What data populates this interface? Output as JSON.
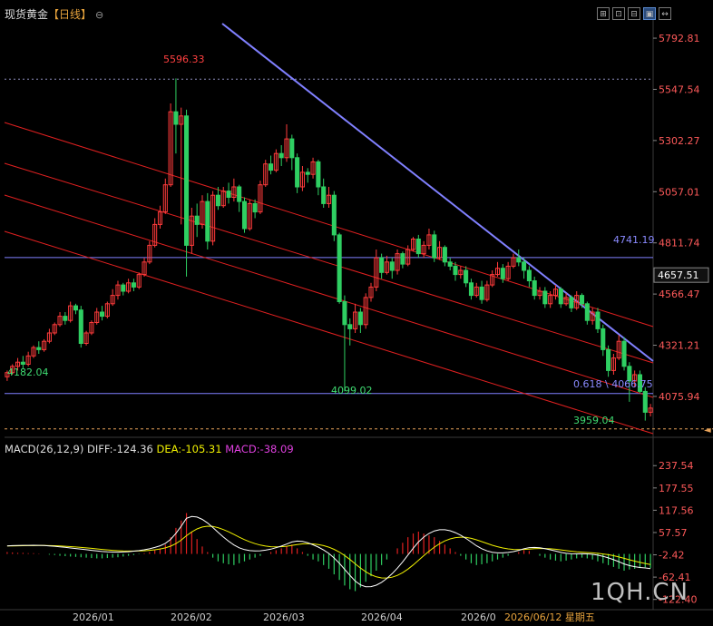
{
  "header": {
    "title": "现货黄金",
    "period": "【日线】",
    "settings_glyph": "⊖"
  },
  "toolbar": {
    "items": [
      {
        "glyph": "⊞",
        "name": "crosshair-icon"
      },
      {
        "glyph": "⊡",
        "name": "zoom-icon"
      },
      {
        "glyph": "⊟",
        "name": "layout-icon"
      },
      {
        "glyph": "▣",
        "name": "chart-type-icon"
      },
      {
        "glyph": "↔",
        "name": "expand-icon"
      }
    ]
  },
  "price_axis": {
    "ticks": [
      "5792.81",
      "5547.54",
      "5302.27",
      "5057.01",
      "4811.74",
      "4566.47",
      "4321.21",
      "4075.94"
    ]
  },
  "current_price": {
    "label": "4657.51",
    "value": 4657.51
  },
  "tail_arrow": "◄",
  "labels": {
    "high": "5596.33",
    "start": "4182.04",
    "low_march": "4099.02",
    "level_4741": "4741.19",
    "fib": "0.618 \\ 4066.75",
    "low_recent": "3959.04"
  },
  "macd": {
    "name": "MACD(26,12,9)",
    "diff_label": "DIFF:-124.36",
    "dea_label": "DEA:-105.31",
    "macd_label": "MACD:-38.09",
    "ticks": [
      "237.54",
      "177.55",
      "117.56",
      "57.57",
      "-2.42",
      "-62.41",
      "-122.40"
    ]
  },
  "x_axis": {
    "labels": [
      "2026/01",
      "2026/02",
      "2026/03",
      "2026/04",
      "2026/0"
    ],
    "cursor_label": "2026/06/12 星期五"
  },
  "watermark": "1QH.CN",
  "colors": {
    "up": "#ff3b3b",
    "down": "#2fcf62",
    "trend": "#8080ff",
    "channel": "#e02020",
    "dash": "#e8a35a",
    "diff": "#ffffff",
    "dea": "#f0f000",
    "hist_up": "#e02020",
    "hist_down": "#2fcf62"
  },
  "chart_data": {
    "type": "candlestick",
    "candles": [
      [
        4170,
        4190,
        4150,
        4200
      ],
      [
        4190,
        4220,
        4180,
        4230
      ],
      [
        4220,
        4240,
        4200,
        4260
      ],
      [
        4240,
        4230,
        4210,
        4270
      ],
      [
        4230,
        4270,
        4220,
        4290
      ],
      [
        4270,
        4310,
        4260,
        4320
      ],
      [
        4310,
        4300,
        4280,
        4340
      ],
      [
        4300,
        4340,
        4290,
        4350
      ],
      [
        4340,
        4380,
        4330,
        4400
      ],
      [
        4380,
        4420,
        4370,
        4430
      ],
      [
        4420,
        4460,
        4410,
        4480
      ],
      [
        4460,
        4440,
        4420,
        4480
      ],
      [
        4440,
        4510,
        4430,
        4530
      ],
      [
        4510,
        4490,
        4470,
        4520
      ],
      [
        4490,
        4330,
        4310,
        4510
      ],
      [
        4330,
        4380,
        4320,
        4390
      ],
      [
        4380,
        4430,
        4370,
        4440
      ],
      [
        4430,
        4480,
        4420,
        4500
      ],
      [
        4480,
        4460,
        4440,
        4510
      ],
      [
        4460,
        4520,
        4450,
        4530
      ],
      [
        4520,
        4560,
        4510,
        4590
      ],
      [
        4560,
        4610,
        4540,
        4630
      ],
      [
        4610,
        4580,
        4560,
        4620
      ],
      [
        4580,
        4620,
        4570,
        4640
      ],
      [
        4620,
        4600,
        4580,
        4640
      ],
      [
        4600,
        4660,
        4590,
        4670
      ],
      [
        4660,
        4720,
        4650,
        4740
      ],
      [
        4720,
        4800,
        4710,
        4820
      ],
      [
        4800,
        4900,
        4790,
        4930
      ],
      [
        4900,
        4960,
        4880,
        4990
      ],
      [
        4960,
        5090,
        4950,
        5120
      ],
      [
        5090,
        5440,
        5080,
        5480
      ],
      [
        5440,
        5380,
        5240,
        5600
      ],
      [
        5380,
        5420,
        4900,
        5460
      ],
      [
        5420,
        4800,
        4650,
        5450
      ],
      [
        4800,
        4940,
        4760,
        4980
      ],
      [
        4940,
        4900,
        4840,
        5000
      ],
      [
        4900,
        5010,
        4880,
        5040
      ],
      [
        5010,
        4820,
        4780,
        5050
      ],
      [
        4820,
        5040,
        4800,
        5060
      ],
      [
        5040,
        4990,
        4970,
        5080
      ],
      [
        4990,
        5060,
        4980,
        5080
      ],
      [
        5060,
        5030,
        5000,
        5100
      ],
      [
        5030,
        5080,
        5010,
        5120
      ],
      [
        5080,
        5010,
        4960,
        5090
      ],
      [
        5010,
        4880,
        4860,
        5030
      ],
      [
        4880,
        5000,
        4870,
        5020
      ],
      [
        5000,
        4960,
        4930,
        5020
      ],
      [
        4960,
        5090,
        4950,
        5110
      ],
      [
        5090,
        5190,
        5080,
        5210
      ],
      [
        5190,
        5160,
        5140,
        5230
      ],
      [
        5160,
        5240,
        5150,
        5260
      ],
      [
        5240,
        5220,
        5180,
        5280
      ],
      [
        5220,
        5310,
        5200,
        5380
      ],
      [
        5310,
        5220,
        5160,
        5330
      ],
      [
        5220,
        5080,
        5050,
        5240
      ],
      [
        5080,
        5150,
        5060,
        5180
      ],
      [
        5150,
        5140,
        5100,
        5170
      ],
      [
        5140,
        5200,
        5120,
        5220
      ],
      [
        5200,
        5080,
        5040,
        5210
      ],
      [
        5080,
        5000,
        4980,
        5120
      ],
      [
        5000,
        5040,
        4980,
        5080
      ],
      [
        5040,
        4850,
        4820,
        5060
      ],
      [
        4850,
        4530,
        4520,
        4860
      ],
      [
        4530,
        4420,
        4100,
        4560
      ],
      [
        4420,
        4400,
        4320,
        4450
      ],
      [
        4400,
        4480,
        4380,
        4520
      ],
      [
        4480,
        4420,
        4380,
        4500
      ],
      [
        4420,
        4550,
        4400,
        4570
      ],
      [
        4550,
        4600,
        4530,
        4620
      ],
      [
        4600,
        4740,
        4580,
        4780
      ],
      [
        4740,
        4670,
        4640,
        4760
      ],
      [
        4670,
        4720,
        4660,
        4750
      ],
      [
        4720,
        4680,
        4640,
        4740
      ],
      [
        4680,
        4760,
        4660,
        4780
      ],
      [
        4760,
        4710,
        4690,
        4770
      ],
      [
        4710,
        4780,
        4700,
        4800
      ],
      [
        4780,
        4830,
        4770,
        4840
      ],
      [
        4830,
        4760,
        4740,
        4850
      ],
      [
        4760,
        4800,
        4740,
        4820
      ],
      [
        4800,
        4850,
        4780,
        4880
      ],
      [
        4850,
        4740,
        4720,
        4870
      ],
      [
        4740,
        4790,
        4730,
        4820
      ],
      [
        4790,
        4720,
        4700,
        4800
      ],
      [
        4720,
        4700,
        4680,
        4740
      ],
      [
        4700,
        4660,
        4630,
        4720
      ],
      [
        4660,
        4680,
        4640,
        4700
      ],
      [
        4680,
        4620,
        4600,
        4700
      ],
      [
        4620,
        4560,
        4540,
        4640
      ],
      [
        4560,
        4600,
        4550,
        4620
      ],
      [
        4600,
        4540,
        4520,
        4630
      ],
      [
        4540,
        4610,
        4530,
        4630
      ],
      [
        4610,
        4660,
        4600,
        4680
      ],
      [
        4660,
        4690,
        4650,
        4720
      ],
      [
        4690,
        4640,
        4620,
        4710
      ],
      [
        4640,
        4700,
        4630,
        4720
      ],
      [
        4700,
        4740,
        4690,
        4760
      ],
      [
        4740,
        4720,
        4700,
        4780
      ],
      [
        4720,
        4680,
        4640,
        4740
      ],
      [
        4680,
        4630,
        4600,
        4700
      ],
      [
        4630,
        4560,
        4540,
        4650
      ],
      [
        4560,
        4580,
        4540,
        4600
      ],
      [
        4580,
        4520,
        4500,
        4600
      ],
      [
        4520,
        4560,
        4500,
        4580
      ],
      [
        4560,
        4590,
        4540,
        4610
      ],
      [
        4590,
        4520,
        4500,
        4600
      ],
      [
        4520,
        4550,
        4510,
        4570
      ],
      [
        4550,
        4500,
        4480,
        4560
      ],
      [
        4500,
        4560,
        4490,
        4580
      ],
      [
        4560,
        4520,
        4500,
        4570
      ],
      [
        4520,
        4440,
        4420,
        4530
      ],
      [
        4440,
        4480,
        4420,
        4500
      ],
      [
        4480,
        4400,
        4380,
        4500
      ],
      [
        4400,
        4300,
        4270,
        4420
      ],
      [
        4300,
        4200,
        4170,
        4320
      ],
      [
        4200,
        4260,
        4180,
        4280
      ],
      [
        4260,
        4340,
        4250,
        4370
      ],
      [
        4340,
        4220,
        4200,
        4360
      ],
      [
        4220,
        4150,
        4050,
        4240
      ],
      [
        4150,
        4180,
        4120,
        4200
      ],
      [
        4180,
        4100,
        4090,
        4200
      ],
      [
        4100,
        4000,
        3960,
        4120
      ],
      [
        4000,
        4020,
        3980,
        4040
      ]
    ],
    "fib_level": 4066.75,
    "horizontal_level": 4741.19,
    "high_price": 5596.33,
    "ylim": [
      3880,
      5880
    ],
    "macd_ylim": [
      -150,
      265
    ],
    "macd_hist": [
      5,
      4,
      3,
      3,
      2,
      2,
      1,
      0,
      -2,
      -3,
      -5,
      -6,
      -7,
      -8,
      -9,
      -10,
      -11,
      -12,
      -12,
      -11,
      -10,
      -9,
      -7,
      -5,
      -3,
      -1,
      2,
      5,
      10,
      15,
      25,
      45,
      70,
      90,
      110,
      60,
      40,
      20,
      5,
      -10,
      -20,
      -25,
      -28,
      -30,
      -25,
      -20,
      -15,
      -10,
      -5,
      0,
      5,
      10,
      15,
      20,
      25,
      15,
      5,
      -5,
      -15,
      -20,
      -30,
      -40,
      -55,
      -70,
      -85,
      -95,
      -100,
      -90,
      -75,
      -60,
      -45,
      -30,
      -15,
      0,
      15,
      30,
      45,
      55,
      60,
      55,
      50,
      45,
      35,
      25,
      15,
      5,
      -5,
      -15,
      -25,
      -30,
      -28,
      -25,
      -20,
      -15,
      -10,
      -5,
      0,
      5,
      10,
      8,
      0,
      -5,
      -10,
      -15,
      -18,
      -20,
      -18,
      -15,
      -12,
      -10,
      -12,
      -15,
      -20,
      -25,
      -30,
      -35,
      -40,
      -45,
      -42,
      -40,
      -38,
      -36,
      -38
    ]
  }
}
